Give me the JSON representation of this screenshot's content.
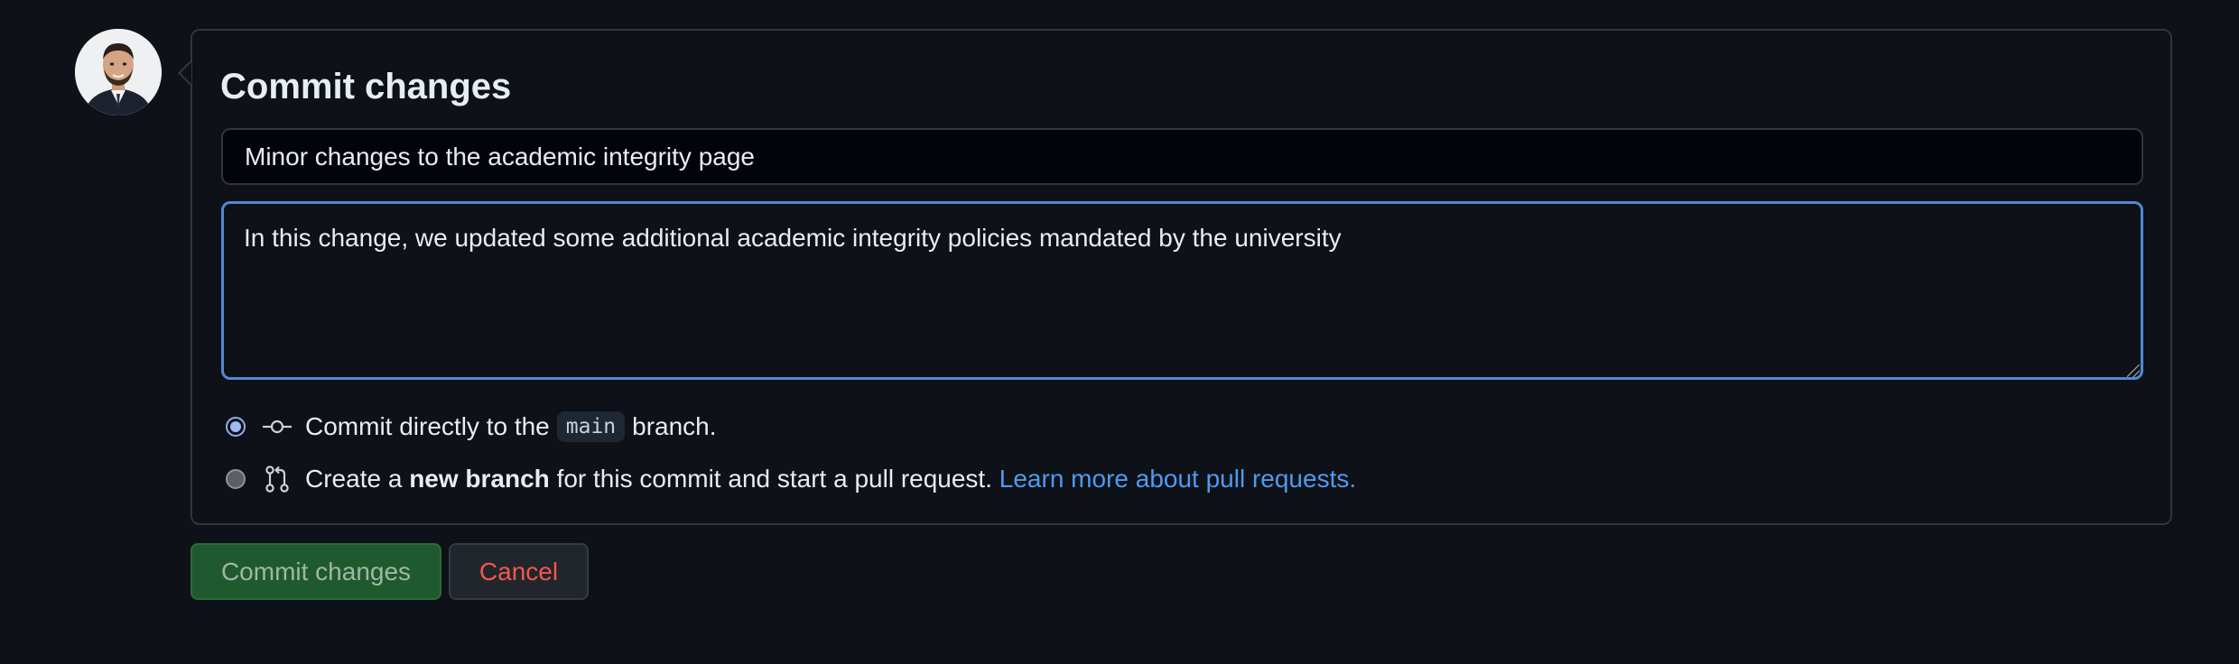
{
  "form": {
    "title": "Commit changes",
    "summary_value": "Minor changes to the academic integrity page",
    "description_value": "In this change, we updated some additional academic integrity policies mandated by the university"
  },
  "options": {
    "direct": {
      "prefix": "Commit directly to the",
      "branch": "main",
      "suffix": "branch.",
      "icon": "git-commit-icon",
      "selected": true
    },
    "new_branch": {
      "prefix": "Create a",
      "bold": "new branch",
      "middle": "for this commit and start a pull request.",
      "link": "Learn more about pull requests.",
      "icon": "git-pull-request-icon",
      "selected": false
    }
  },
  "buttons": {
    "commit": "Commit changes",
    "cancel": "Cancel"
  },
  "colors": {
    "background": "#0e1117",
    "accent_border": "#4f8ad6",
    "link": "#4d9bf0",
    "commit_button": "#1f5a2e",
    "cancel_text": "#f2574d"
  }
}
